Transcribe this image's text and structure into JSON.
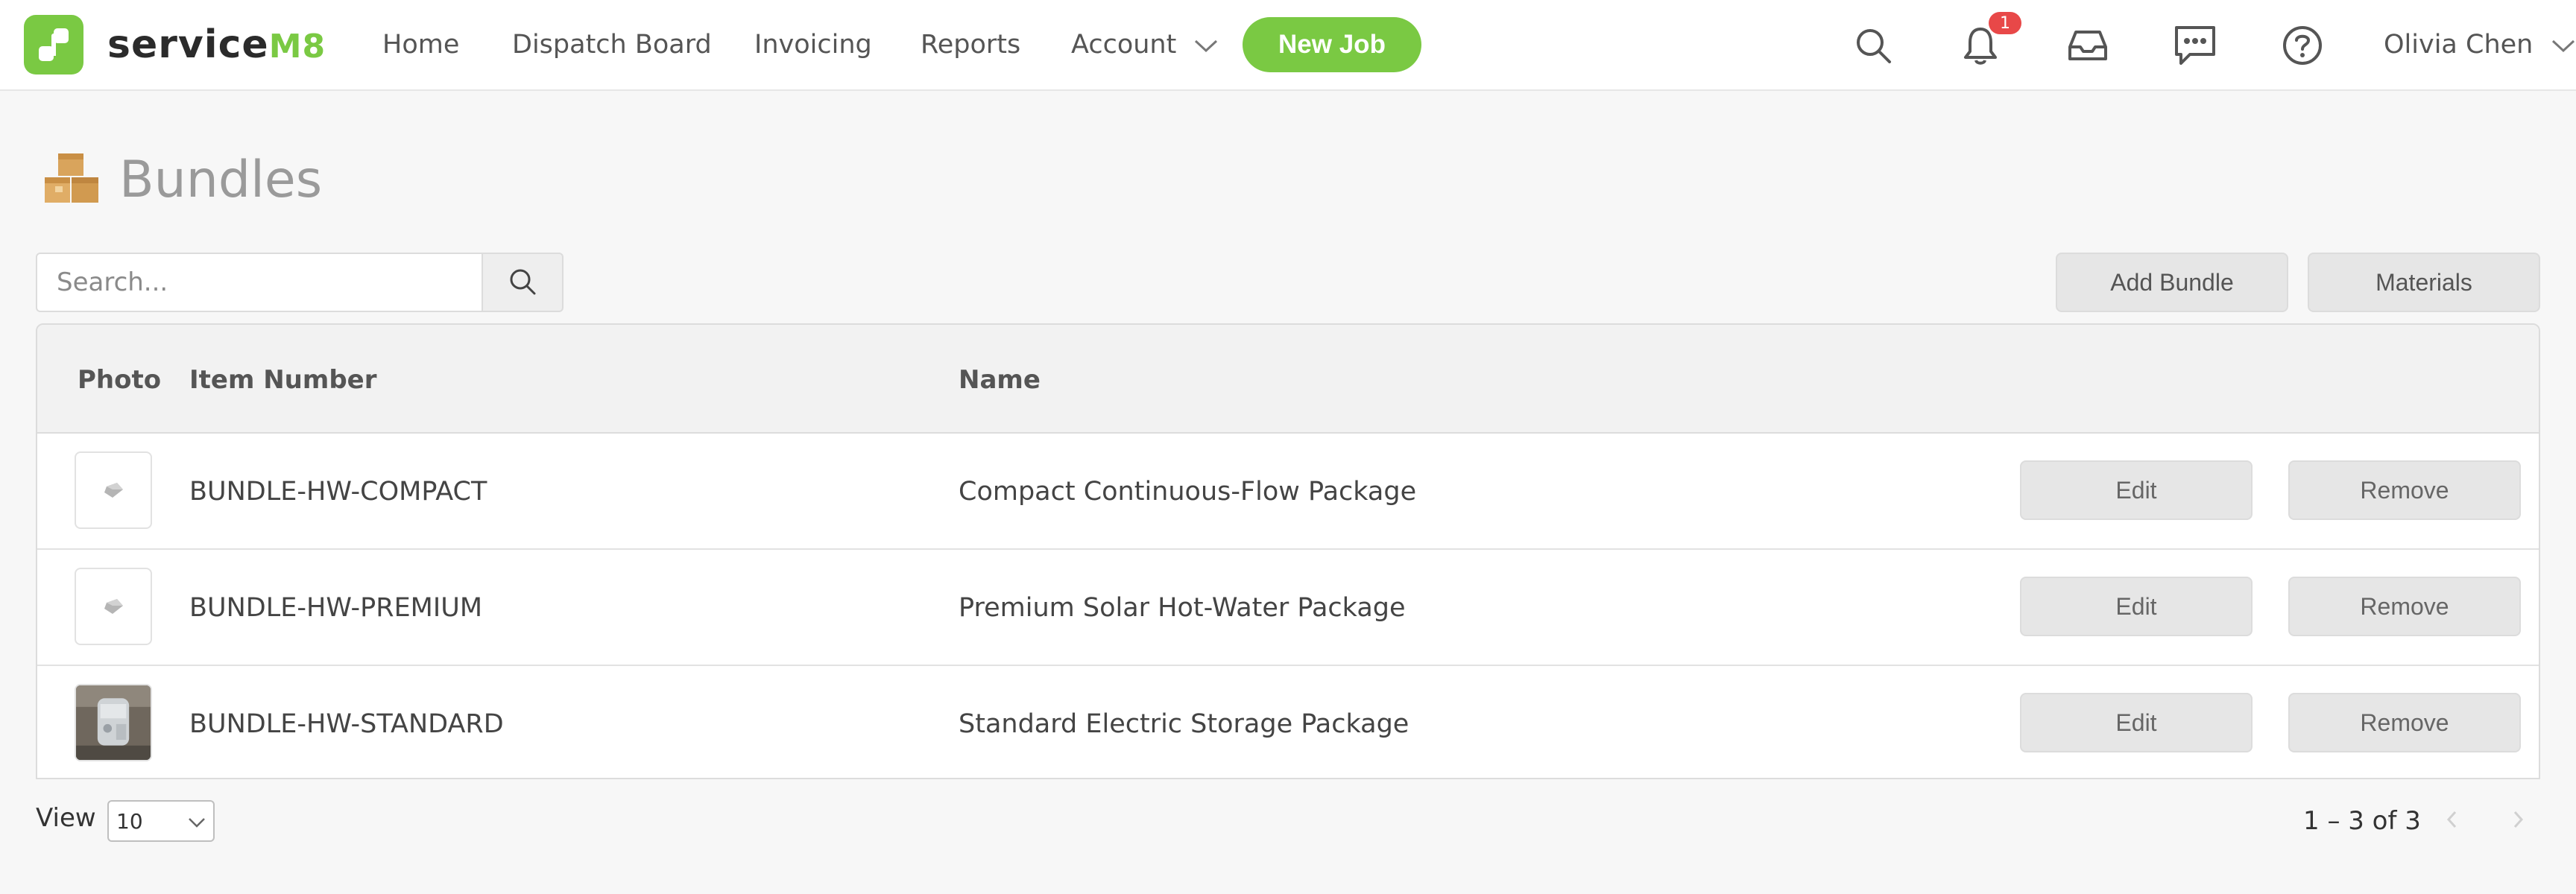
{
  "header": {
    "logo_text": "service",
    "logo_accent": "M8",
    "nav": [
      {
        "label": "Home"
      },
      {
        "label": "Dispatch Board"
      },
      {
        "label": "Invoicing"
      },
      {
        "label": "Reports"
      },
      {
        "label": "Account"
      }
    ],
    "new_job_label": "New Job",
    "notification_count": "1",
    "user_name": "Olivia Chen",
    "icons": [
      "search-icon",
      "bell-icon",
      "inbox-icon",
      "chat-icon",
      "help-icon"
    ]
  },
  "page": {
    "title": "Bundles",
    "title_icon": "boxes-icon"
  },
  "toolbar": {
    "search_placeholder": "Search...",
    "add_bundle_label": "Add Bundle",
    "materials_label": "Materials"
  },
  "table": {
    "columns": {
      "photo": "Photo",
      "item_number": "Item Number",
      "name": "Name"
    },
    "rows": [
      {
        "item_number": "BUNDLE-HW-COMPACT",
        "name": "Compact Continuous-Flow Package",
        "edit": "Edit",
        "remove": "Remove",
        "photo": "placeholder"
      },
      {
        "item_number": "BUNDLE-HW-PREMIUM",
        "name": "Premium Solar Hot-Water Package",
        "edit": "Edit",
        "remove": "Remove",
        "photo": "placeholder"
      },
      {
        "item_number": "BUNDLE-HW-STANDARD",
        "name": "Standard Electric Storage Package",
        "edit": "Edit",
        "remove": "Remove",
        "photo": "image"
      }
    ]
  },
  "footer": {
    "view_label": "View",
    "page_size": "10",
    "pagination": "1 – 3 of 3"
  },
  "colors": {
    "brand_green": "#7ac943",
    "badge_red": "#e84848",
    "background": "#f7f7f7"
  }
}
